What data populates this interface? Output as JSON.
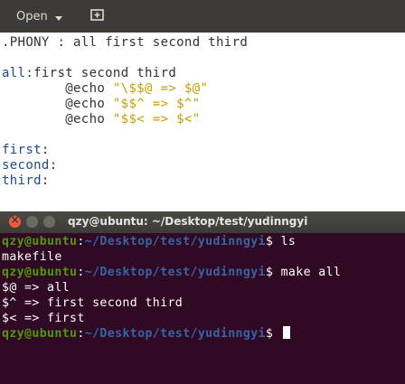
{
  "header": {
    "open_label": "Open",
    "new_window_icon": "new-window-icon"
  },
  "editor": {
    "lines": [
      {
        "seg": [
          {
            "t": ".PHONY : all first second third",
            "c": "kw-cmd"
          }
        ]
      },
      {
        "seg": []
      },
      {
        "seg": [
          {
            "t": "all",
            "c": "kw-target"
          },
          {
            "t": ":first second third",
            "c": "kw-cmd"
          }
        ]
      },
      {
        "seg": [
          {
            "t": "        @echo ",
            "c": "kw-cmd"
          },
          {
            "t": "\"\\$$@ => $@\"",
            "c": "kw-str"
          }
        ]
      },
      {
        "seg": [
          {
            "t": "        @echo ",
            "c": "kw-cmd"
          },
          {
            "t": "\"$$^ => $^\"",
            "c": "kw-str"
          }
        ]
      },
      {
        "seg": [
          {
            "t": "        @echo ",
            "c": "kw-cmd"
          },
          {
            "t": "\"$$< => $<\"",
            "c": "kw-str"
          }
        ]
      },
      {
        "seg": []
      },
      {
        "seg": [
          {
            "t": "first",
            "c": "kw-target"
          },
          {
            "t": ":",
            "c": "kw-cmd"
          }
        ]
      },
      {
        "seg": [
          {
            "t": "second",
            "c": "kw-target"
          },
          {
            "t": ":",
            "c": "kw-cmd"
          }
        ]
      },
      {
        "seg": [
          {
            "t": "third",
            "c": "kw-target"
          },
          {
            "t": ":",
            "c": "kw-cmd"
          }
        ]
      }
    ]
  },
  "terminal": {
    "title": "qzy@ubuntu: ~/Desktop/test/yudinngyi",
    "prompt_user": "qzy@ubuntu",
    "prompt_path": "~/Desktop/test/yudinngyi",
    "lines": [
      {
        "type": "prompt",
        "cmd": "ls"
      },
      {
        "type": "out",
        "text": "makefile"
      },
      {
        "type": "prompt",
        "cmd": "make all"
      },
      {
        "type": "out",
        "text": "$@ => all"
      },
      {
        "type": "out",
        "text": "$^ => first second third"
      },
      {
        "type": "out",
        "text": "$< => first"
      },
      {
        "type": "prompt",
        "cmd": ""
      }
    ]
  }
}
